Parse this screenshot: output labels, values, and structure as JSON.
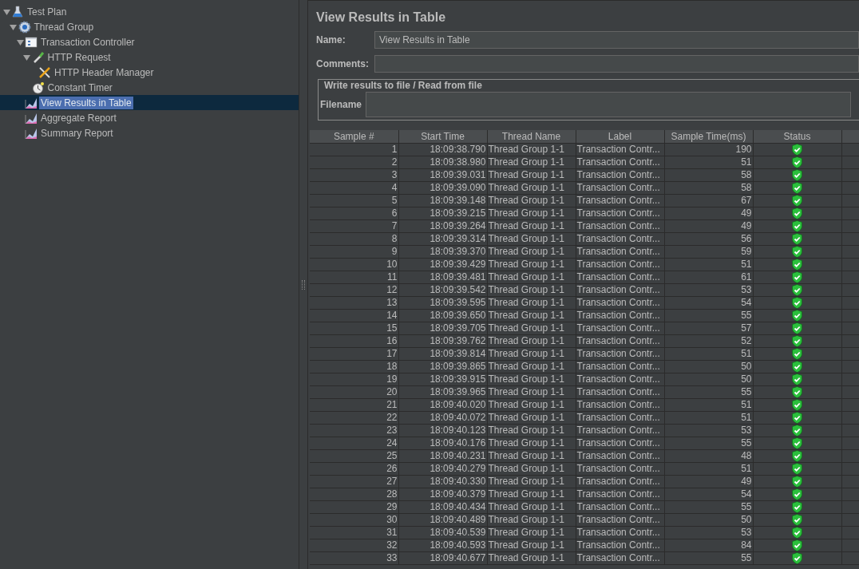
{
  "tree": [
    {
      "label": "Test Plan",
      "kind": "plan",
      "expanded": true,
      "selected": false,
      "children": [
        {
          "label": "Thread Group",
          "kind": "threads",
          "expanded": true,
          "selected": false,
          "children": [
            {
              "label": "Transaction Controller",
              "kind": "controller",
              "expanded": true,
              "selected": false,
              "children": [
                {
                  "label": "HTTP Request",
                  "kind": "sampler",
                  "expanded": true,
                  "selected": false,
                  "children": [
                    {
                      "label": "HTTP Header Manager",
                      "kind": "config",
                      "selected": false
                    }
                  ]
                },
                {
                  "label": "Constant Timer",
                  "kind": "timer",
                  "selected": false
                }
              ]
            },
            {
              "label": "View Results in Table",
              "kind": "listener",
              "selected": true
            },
            {
              "label": "Aggregate Report",
              "kind": "listener",
              "selected": false
            },
            {
              "label": "Summary Report",
              "kind": "listener",
              "selected": false
            }
          ]
        }
      ]
    }
  ],
  "panel": {
    "title": "View Results in Table",
    "name_label": "Name:",
    "name_value": "View Results in Table",
    "comments_label": "Comments:",
    "group_title": "Write results to file / Read from file",
    "filename_label": "Filename"
  },
  "table": {
    "columns": [
      "Sample #",
      "Start Time",
      "Thread Name",
      "Label",
      "Sample Time(ms)",
      "Status"
    ],
    "rows": [
      {
        "sample": "1",
        "start": "18:09:38.790",
        "thread": "Thread Group 1-1",
        "label": "Transaction Contr...",
        "time": "190",
        "ok": true
      },
      {
        "sample": "2",
        "start": "18:09:38.980",
        "thread": "Thread Group 1-1",
        "label": "Transaction Contr...",
        "time": "51",
        "ok": true
      },
      {
        "sample": "3",
        "start": "18:09:39.031",
        "thread": "Thread Group 1-1",
        "label": "Transaction Contr...",
        "time": "58",
        "ok": true
      },
      {
        "sample": "4",
        "start": "18:09:39.090",
        "thread": "Thread Group 1-1",
        "label": "Transaction Contr...",
        "time": "58",
        "ok": true
      },
      {
        "sample": "5",
        "start": "18:09:39.148",
        "thread": "Thread Group 1-1",
        "label": "Transaction Contr...",
        "time": "67",
        "ok": true
      },
      {
        "sample": "6",
        "start": "18:09:39.215",
        "thread": "Thread Group 1-1",
        "label": "Transaction Contr...",
        "time": "49",
        "ok": true
      },
      {
        "sample": "7",
        "start": "18:09:39.264",
        "thread": "Thread Group 1-1",
        "label": "Transaction Contr...",
        "time": "49",
        "ok": true
      },
      {
        "sample": "8",
        "start": "18:09:39.314",
        "thread": "Thread Group 1-1",
        "label": "Transaction Contr...",
        "time": "56",
        "ok": true
      },
      {
        "sample": "9",
        "start": "18:09:39.370",
        "thread": "Thread Group 1-1",
        "label": "Transaction Contr...",
        "time": "59",
        "ok": true
      },
      {
        "sample": "10",
        "start": "18:09:39.429",
        "thread": "Thread Group 1-1",
        "label": "Transaction Contr...",
        "time": "51",
        "ok": true
      },
      {
        "sample": "11",
        "start": "18:09:39.481",
        "thread": "Thread Group 1-1",
        "label": "Transaction Contr...",
        "time": "61",
        "ok": true
      },
      {
        "sample": "12",
        "start": "18:09:39.542",
        "thread": "Thread Group 1-1",
        "label": "Transaction Contr...",
        "time": "53",
        "ok": true
      },
      {
        "sample": "13",
        "start": "18:09:39.595",
        "thread": "Thread Group 1-1",
        "label": "Transaction Contr...",
        "time": "54",
        "ok": true
      },
      {
        "sample": "14",
        "start": "18:09:39.650",
        "thread": "Thread Group 1-1",
        "label": "Transaction Contr...",
        "time": "55",
        "ok": true
      },
      {
        "sample": "15",
        "start": "18:09:39.705",
        "thread": "Thread Group 1-1",
        "label": "Transaction Contr...",
        "time": "57",
        "ok": true
      },
      {
        "sample": "16",
        "start": "18:09:39.762",
        "thread": "Thread Group 1-1",
        "label": "Transaction Contr...",
        "time": "52",
        "ok": true
      },
      {
        "sample": "17",
        "start": "18:09:39.814",
        "thread": "Thread Group 1-1",
        "label": "Transaction Contr...",
        "time": "51",
        "ok": true
      },
      {
        "sample": "18",
        "start": "18:09:39.865",
        "thread": "Thread Group 1-1",
        "label": "Transaction Contr...",
        "time": "50",
        "ok": true
      },
      {
        "sample": "19",
        "start": "18:09:39.915",
        "thread": "Thread Group 1-1",
        "label": "Transaction Contr...",
        "time": "50",
        "ok": true
      },
      {
        "sample": "20",
        "start": "18:09:39.965",
        "thread": "Thread Group 1-1",
        "label": "Transaction Contr...",
        "time": "55",
        "ok": true
      },
      {
        "sample": "21",
        "start": "18:09:40.020",
        "thread": "Thread Group 1-1",
        "label": "Transaction Contr...",
        "time": "51",
        "ok": true
      },
      {
        "sample": "22",
        "start": "18:09:40.072",
        "thread": "Thread Group 1-1",
        "label": "Transaction Contr...",
        "time": "51",
        "ok": true
      },
      {
        "sample": "23",
        "start": "18:09:40.123",
        "thread": "Thread Group 1-1",
        "label": "Transaction Contr...",
        "time": "53",
        "ok": true
      },
      {
        "sample": "24",
        "start": "18:09:40.176",
        "thread": "Thread Group 1-1",
        "label": "Transaction Contr...",
        "time": "55",
        "ok": true
      },
      {
        "sample": "25",
        "start": "18:09:40.231",
        "thread": "Thread Group 1-1",
        "label": "Transaction Contr...",
        "time": "48",
        "ok": true
      },
      {
        "sample": "26",
        "start": "18:09:40.279",
        "thread": "Thread Group 1-1",
        "label": "Transaction Contr...",
        "time": "51",
        "ok": true
      },
      {
        "sample": "27",
        "start": "18:09:40.330",
        "thread": "Thread Group 1-1",
        "label": "Transaction Contr...",
        "time": "49",
        "ok": true
      },
      {
        "sample": "28",
        "start": "18:09:40.379",
        "thread": "Thread Group 1-1",
        "label": "Transaction Contr...",
        "time": "54",
        "ok": true
      },
      {
        "sample": "29",
        "start": "18:09:40.434",
        "thread": "Thread Group 1-1",
        "label": "Transaction Contr...",
        "time": "55",
        "ok": true
      },
      {
        "sample": "30",
        "start": "18:09:40.489",
        "thread": "Thread Group 1-1",
        "label": "Transaction Contr...",
        "time": "50",
        "ok": true
      },
      {
        "sample": "31",
        "start": "18:09:40.539",
        "thread": "Thread Group 1-1",
        "label": "Transaction Contr...",
        "time": "53",
        "ok": true
      },
      {
        "sample": "32",
        "start": "18:09:40.593",
        "thread": "Thread Group 1-1",
        "label": "Transaction Contr...",
        "time": "84",
        "ok": true
      },
      {
        "sample": "33",
        "start": "18:09:40.677",
        "thread": "Thread Group 1-1",
        "label": "Transaction Contr...",
        "time": "55",
        "ok": true
      }
    ]
  }
}
